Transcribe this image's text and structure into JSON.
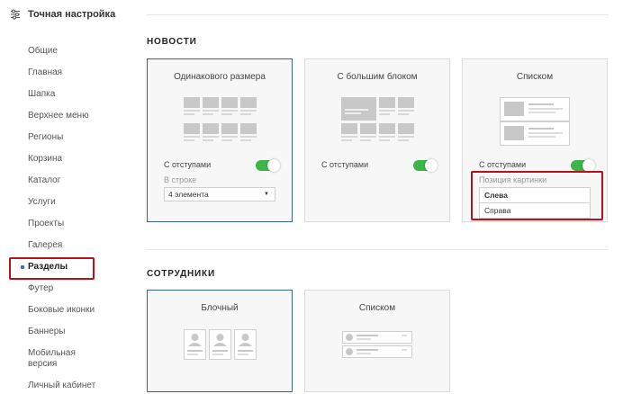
{
  "sidebar": {
    "title": "Точная настройка",
    "icon": "sliders-icon",
    "items": [
      {
        "label": "Общие"
      },
      {
        "label": "Главная"
      },
      {
        "label": "Шапка"
      },
      {
        "label": "Верхнее меню"
      },
      {
        "label": "Регионы"
      },
      {
        "label": "Корзина"
      },
      {
        "label": "Каталог"
      },
      {
        "label": "Услуги"
      },
      {
        "label": "Проекты"
      },
      {
        "label": "Галерея"
      },
      {
        "label": "Разделы",
        "active": true
      },
      {
        "label": "Футер"
      },
      {
        "label": "Боковые иконки"
      },
      {
        "label": "Баннеры"
      },
      {
        "label": "Мобильная версия"
      },
      {
        "label": "Личный кабинет"
      }
    ]
  },
  "news": {
    "title": "НОВОСТИ",
    "cards": [
      {
        "name": "Одинакового размера",
        "selected": true,
        "toggle_label": "С отступами",
        "toggle_on": true,
        "sub_label": "В строке",
        "select_value": "4 элемента"
      },
      {
        "name": "С большим блоком",
        "selected": false,
        "toggle_label": "С отступами",
        "toggle_on": true
      },
      {
        "name": "Списком",
        "selected": false,
        "toggle_label": "С отступами",
        "toggle_on": true,
        "sub_label": "Позиция картинки",
        "options": [
          "Слева",
          "Справа"
        ],
        "selected_option": "Слева"
      }
    ]
  },
  "staff": {
    "title": "СОТРУДНИКИ",
    "cards": [
      {
        "name": "Блочный",
        "selected": true
      },
      {
        "name": "Списком",
        "selected": false
      }
    ]
  },
  "colors": {
    "accent": "#3b5f99",
    "toggle_on": "#3cb54a",
    "highlight": "#b5121b"
  }
}
